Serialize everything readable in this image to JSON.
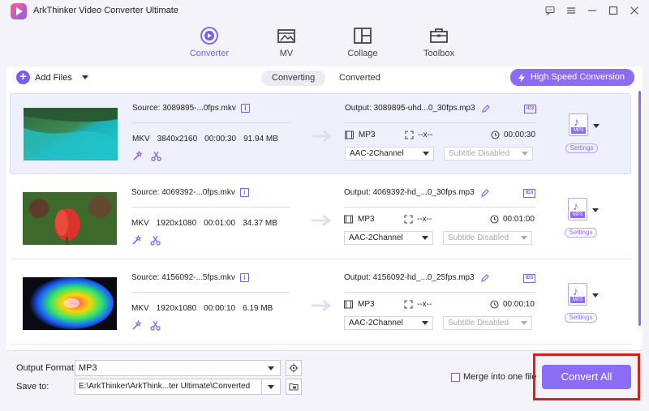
{
  "app": {
    "title": "ArkThinker Video Converter Ultimate"
  },
  "nav": [
    {
      "label": "Converter",
      "icon": "converter-icon",
      "active": true
    },
    {
      "label": "MV",
      "icon": "mv-icon",
      "active": false
    },
    {
      "label": "Collage",
      "icon": "collage-icon",
      "active": false
    },
    {
      "label": "Toolbox",
      "icon": "toolbox-icon",
      "active": false
    }
  ],
  "toolbar": {
    "add_files": "Add Files",
    "tab_converting": "Converting",
    "tab_converted": "Converted",
    "high_speed": "High Speed Conversion"
  },
  "files": [
    {
      "source": "Source: 3089895-...0fps.mkv",
      "container": "MKV",
      "resolution": "3840x2160",
      "duration": "00:00:30",
      "size": "91.94 MB",
      "output": "Output: 3089895-uhd...0_30fps.mp3",
      "out_format": "MP3",
      "out_resolution": "--x--",
      "out_duration": "00:00:30",
      "audio": "AAC-2Channel",
      "subtitle": "Subtitle Disabled",
      "settings": "Settings",
      "format_badge": "MP3"
    },
    {
      "source": "Source: 4069392-...0fps.mkv",
      "container": "MKV",
      "resolution": "1920x1080",
      "duration": "00:01:00",
      "size": "34.37 MB",
      "output": "Output: 4069392-hd_...0_30fps.mp3",
      "out_format": "MP3",
      "out_resolution": "--x--",
      "out_duration": "00:01:00",
      "audio": "AAC-2Channel",
      "subtitle": "Subtitle Disabled",
      "settings": "Settings",
      "format_badge": "MP3"
    },
    {
      "source": "Source: 4156092-...5fps.mkv",
      "container": "MKV",
      "resolution": "1920x1080",
      "duration": "00:00:10",
      "size": "6.19 MB",
      "output": "Output: 4156092-hd_...0_25fps.mp3",
      "out_format": "MP3",
      "out_resolution": "--x--",
      "out_duration": "00:00:10",
      "audio": "AAC-2Channel",
      "subtitle": "Subtitle Disabled",
      "settings": "Settings",
      "format_badge": "MP3"
    }
  ],
  "bottom": {
    "output_format_label": "Output Format:",
    "output_format_value": "MP3",
    "save_to_label": "Save to:",
    "save_to_value": "E:\\ArkThinker\\ArkThink...ter Ultimate\\Converted",
    "merge_label": "Merge into one file",
    "convert_all": "Convert All"
  },
  "colors": {
    "accent": "#8b6cf5",
    "highlight_frame": "#e01d1d"
  }
}
